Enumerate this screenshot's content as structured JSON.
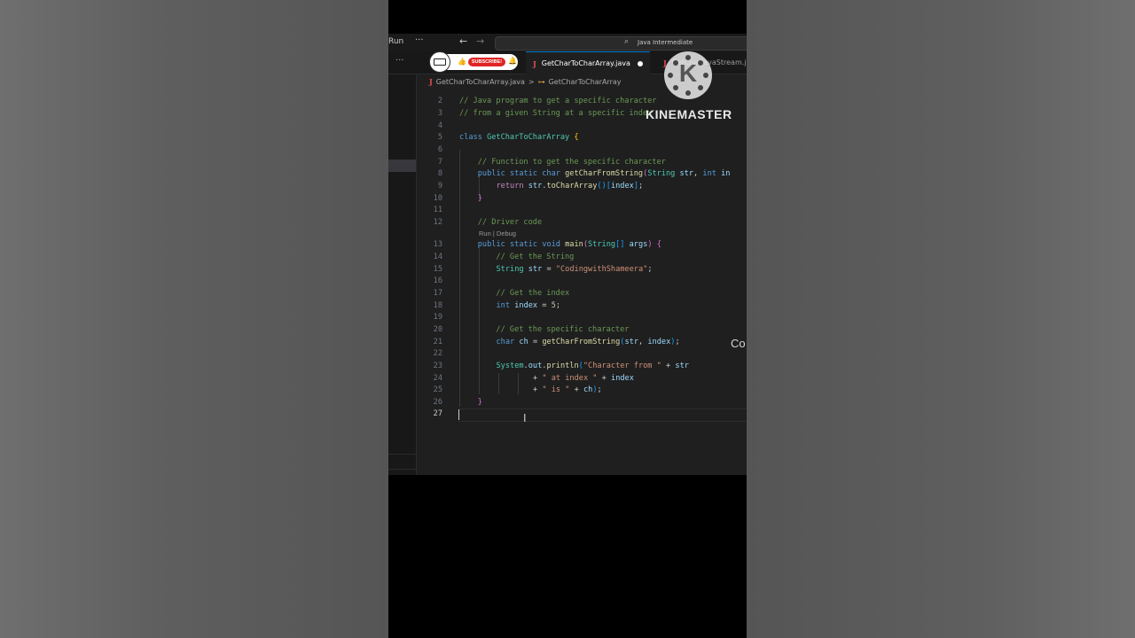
{
  "titlebar": {
    "run_label": "Run",
    "more_label": "···",
    "search_text": "Java Intermediate"
  },
  "tabs": [
    {
      "label": "GetCharToCharArray.java",
      "active": true,
      "modified": true
    },
    {
      "label": "GetCharJavaStream.java",
      "active": false,
      "modified": false
    }
  ],
  "breadcrumb": {
    "file": "GetCharToCharArray.java",
    "separator": ">",
    "symbol": "GetCharToCharArray"
  },
  "codelens": "Run | Debug",
  "code_lines": [
    {
      "n": "2",
      "text": "// Java program to get a specific character"
    },
    {
      "n": "3",
      "text": "// from a given String at a specific index"
    },
    {
      "n": "4",
      "text": ""
    },
    {
      "n": "5",
      "text": "class GetCharToCharArray {"
    },
    {
      "n": "6",
      "text": ""
    },
    {
      "n": "7",
      "text": "    // Function to get the specific character"
    },
    {
      "n": "8",
      "text": "    public static char getCharFromString(String str, int in"
    },
    {
      "n": "9",
      "text": "        return str.toCharArray()[index];"
    },
    {
      "n": "10",
      "text": "    }"
    },
    {
      "n": "11",
      "text": ""
    },
    {
      "n": "12",
      "text": "    // Driver code"
    },
    {
      "n": "13",
      "text": "    public static void main(String[] args) {"
    },
    {
      "n": "14",
      "text": "        // Get the String"
    },
    {
      "n": "15",
      "text": "        String str = \"CodingwithShameera\";"
    },
    {
      "n": "16",
      "text": ""
    },
    {
      "n": "17",
      "text": "        // Get the index"
    },
    {
      "n": "18",
      "text": "        int index = 5;"
    },
    {
      "n": "19",
      "text": ""
    },
    {
      "n": "20",
      "text": "        // Get the specific character"
    },
    {
      "n": "21",
      "text": "        char ch = getCharFromString(str, index);"
    },
    {
      "n": "22",
      "text": ""
    },
    {
      "n": "23",
      "text": "        System.out.println(\"Character from \" + str"
    },
    {
      "n": "24",
      "text": "                + \" at index \" + index"
    },
    {
      "n": "25",
      "text": "                + \" is \" + ch);"
    },
    {
      "n": "26",
      "text": "    }"
    },
    {
      "n": "27",
      "text": ""
    }
  ],
  "overlays": {
    "kinemaster_wordmark": "KINEMASTER",
    "kinemaster_logo_letter": "K",
    "subscribe_label": "SUBSCRIBE!",
    "side_caption": "Co"
  },
  "colors": {
    "editor_bg": "#1f1f1f",
    "comment": "#6a9955",
    "keyword": "#569cd6",
    "string": "#ce9178",
    "subscribe_red": "#e02424"
  }
}
